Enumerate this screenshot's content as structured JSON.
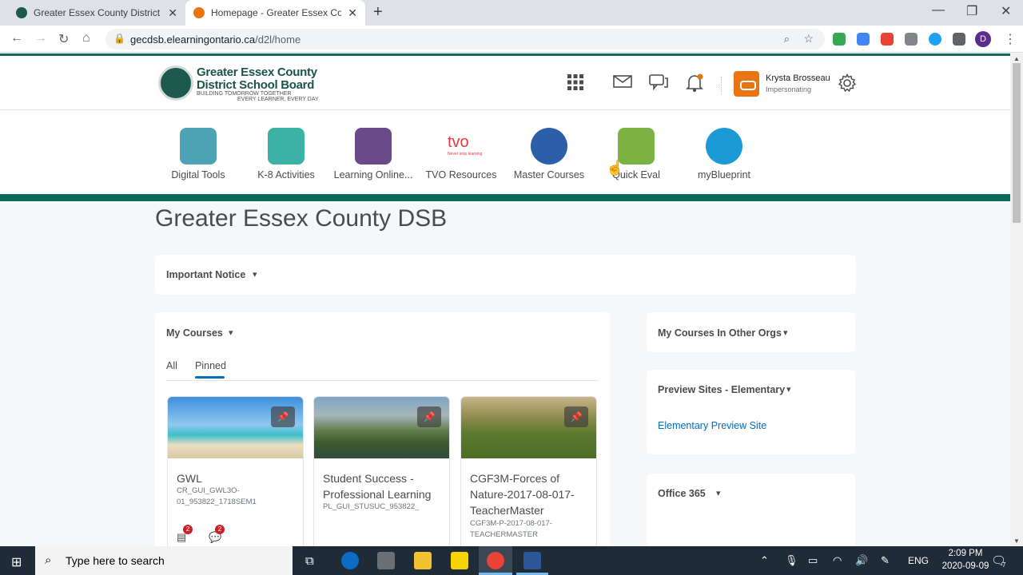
{
  "browser": {
    "tabs": [
      {
        "title": "Greater Essex County District Sch",
        "favicon_color": "#1d5a4d",
        "active": false
      },
      {
        "title": "Homepage - Greater Essex Coun",
        "favicon_color": "#e87511",
        "active": true
      }
    ],
    "url_host": "gecdsb.elearningontario.ca",
    "url_path": "/d2l/home",
    "profile_initial": "D"
  },
  "header": {
    "logo_line1": "Greater Essex County",
    "logo_line2": "District School Board",
    "logo_tagline1": "BUILDING TOMORROW TOGETHER",
    "logo_tagline2": "EVERY LEARNER, EVERY DAY",
    "user_name": "Krysta Brosseau",
    "user_status": "Impersonating"
  },
  "navbar": {
    "items": [
      {
        "label": "Digital Tools",
        "color": "#4fa3b5"
      },
      {
        "label": "K-8 Activities",
        "color": "#3bb2a5"
      },
      {
        "label": "Learning Online...",
        "color": "#6b4a8a"
      },
      {
        "label": "TVO Resources",
        "color": "#ffffff"
      },
      {
        "label": "Master Courses",
        "color": "#2b5fa8"
      },
      {
        "label": "Quick Eval",
        "color": "#7bb241"
      },
      {
        "label": "myBlueprint",
        "color": "#1c9ad6"
      }
    ],
    "tvo_logo": "tvo",
    "tvo_tagline": "Never stop learning"
  },
  "main": {
    "title": "Greater Essex County DSB",
    "important_notice": "Important Notice",
    "my_courses": {
      "title": "My Courses",
      "tab_all": "All",
      "tab_pinned": "Pinned",
      "courses": [
        {
          "name": "GWL",
          "code": "CR_GUI_GWL3O-01_953822_1718SEM1",
          "alerts": "2",
          "discussions": "2"
        },
        {
          "name": "Student Success - Professional Learning",
          "code": "PL_GUI_STUSUC_953822_"
        },
        {
          "name": "CGF3M-Forces of Nature-2017-08-017-TeacherMaster",
          "code": "CGF3M-P-2017-08-017-TEACHERMASTER"
        }
      ]
    },
    "side": {
      "other_orgs": "My Courses In Other Orgs",
      "preview_title": "Preview Sites - Elementary",
      "preview_link": "Elementary Preview Site",
      "office_title": "Office 365"
    }
  },
  "taskbar": {
    "search_placeholder": "Type here to search",
    "lang": "ENG",
    "time": "2:09 PM",
    "date": "2020-09-09",
    "notif_count": "7"
  }
}
